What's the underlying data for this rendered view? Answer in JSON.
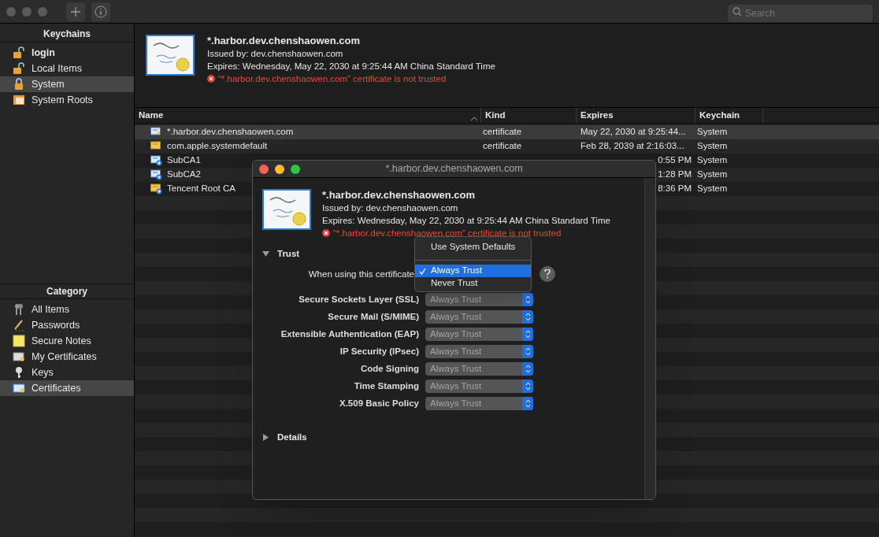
{
  "toolbar": {
    "search": {
      "placeholder": "Search"
    }
  },
  "keychains": {
    "title": "Keychains",
    "items": [
      {
        "label": "login",
        "default": true,
        "selected": false
      },
      {
        "label": "Local Items",
        "default": false,
        "selected": false
      },
      {
        "label": "System",
        "default": false,
        "selected": true
      },
      {
        "label": "System Roots",
        "default": false,
        "selected": false
      }
    ]
  },
  "category": {
    "title": "Category",
    "items": [
      {
        "label": "All Items",
        "selected": false
      },
      {
        "label": "Passwords",
        "selected": false
      },
      {
        "label": "Secure Notes",
        "selected": false
      },
      {
        "label": "My Certificates",
        "selected": false
      },
      {
        "label": "Keys",
        "selected": false
      },
      {
        "label": "Certificates",
        "selected": true
      }
    ]
  },
  "detail": {
    "name": "*.harbor.dev.chenshaowen.com",
    "issued": "Issued by: dev.chenshaowen.com",
    "expires": "Expires: Wednesday, May 22, 2030 at 9:25:44 AM China Standard Time",
    "warning": "“*.harbor.dev.chenshaowen.com” certificate is not trusted"
  },
  "table": {
    "columns": [
      "Name",
      "Kind",
      "Expires",
      "Keychain"
    ],
    "rows": [
      {
        "name": "*.harbor.dev.chenshaowen.com",
        "kind": "certificate",
        "expires": "May 22, 2030 at 9:25:44...",
        "keychain": "System",
        "selected": true
      },
      {
        "name": "com.apple.systemdefault",
        "kind": "certificate",
        "expires": "Feb 28, 2039 at 2:16:03...",
        "keychain": "System",
        "selected": false
      },
      {
        "name": "SubCA1",
        "expires": "0:55 PM",
        "keychain": "System",
        "selected": false
      },
      {
        "name": "SubCA2",
        "expires": "1:28 PM",
        "keychain": "System",
        "selected": false
      },
      {
        "name": "Tencent Root CA",
        "expires": "8:36 PM",
        "keychain": "System",
        "selected": false
      }
    ]
  },
  "dialog": {
    "title": "*.harbor.dev.chenshaowen.com",
    "name": "*.harbor.dev.chenshaowen.com",
    "issued": "Issued by: dev.chenshaowen.com",
    "expires": "Expires: Wednesday, May 22, 2030 at 9:25:44 AM China Standard Time",
    "warning": "“*.harbor.dev.chenshaowen.com” certificate is not trusted",
    "trust": {
      "label": "Trust",
      "expanded": true,
      "when_label": "When using this certificate",
      "menu": [
        {
          "label": "Use System Defaults",
          "selected": false
        },
        {
          "label": "Always Trust",
          "selected": true
        },
        {
          "label": "Never Trust",
          "selected": false
        }
      ],
      "policies": [
        {
          "label": "Secure Sockets Layer (SSL)",
          "value": "Always Trust"
        },
        {
          "label": "Secure Mail (S/MIME)",
          "value": "Always Trust"
        },
        {
          "label": "Extensible Authentication (EAP)",
          "value": "Always Trust"
        },
        {
          "label": "IP Security (IPsec)",
          "value": "Always Trust"
        },
        {
          "label": "Code Signing",
          "value": "Always Trust"
        },
        {
          "label": "Time Stamping",
          "value": "Always Trust"
        },
        {
          "label": "X.509 Basic Policy",
          "value": "Always Trust"
        }
      ]
    },
    "details": {
      "label": "Details",
      "expanded": false
    }
  }
}
